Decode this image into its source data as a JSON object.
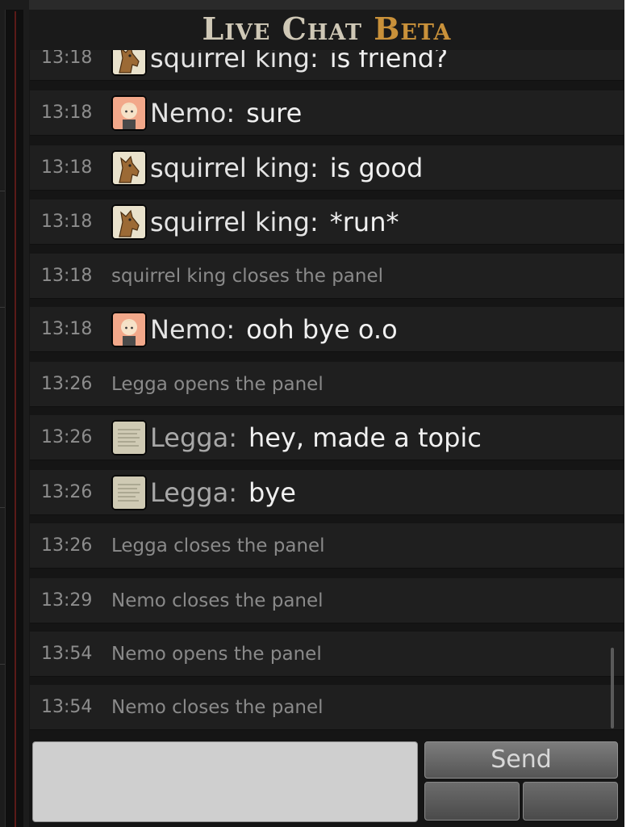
{
  "header": {
    "title_main": "Live Chat",
    "title_beta": "Beta"
  },
  "messages": [
    {
      "time": "13:18",
      "kind": "chat",
      "user": "squirrel king",
      "avatar": "horse",
      "text": "is friend?"
    },
    {
      "time": "13:18",
      "kind": "chat",
      "user": "Nemo",
      "avatar": "girl",
      "text": "sure"
    },
    {
      "time": "13:18",
      "kind": "chat",
      "user": "squirrel king",
      "avatar": "horse",
      "text": "is good"
    },
    {
      "time": "13:18",
      "kind": "chat",
      "user": "squirrel king",
      "avatar": "horse",
      "text": "*run*"
    },
    {
      "time": "13:18",
      "kind": "event",
      "text": "squirrel king closes the panel"
    },
    {
      "time": "13:18",
      "kind": "chat",
      "user": "Nemo",
      "avatar": "girl",
      "text": "ooh bye o.o"
    },
    {
      "time": "13:26",
      "kind": "event",
      "text": "Legga opens the panel"
    },
    {
      "time": "13:26",
      "kind": "chat",
      "user": "Legga",
      "avatar": "paper",
      "dim": true,
      "text": "hey, made a topic"
    },
    {
      "time": "13:26",
      "kind": "chat",
      "user": "Legga",
      "avatar": "paper",
      "dim": true,
      "text": "bye"
    },
    {
      "time": "13:26",
      "kind": "event",
      "text": "Legga closes the panel"
    },
    {
      "time": "13:29",
      "kind": "event",
      "text": "Nemo closes the panel"
    },
    {
      "time": "13:54",
      "kind": "event",
      "text": "Nemo opens the panel"
    },
    {
      "time": "13:54",
      "kind": "event",
      "text": "Nemo closes the panel"
    }
  ],
  "composer": {
    "message_value": "",
    "send_label": "Send"
  },
  "colors": {
    "beta_accent": "#c9913a",
    "title_text": "#cfc8b6",
    "row_bg": "#1f1f1f"
  }
}
